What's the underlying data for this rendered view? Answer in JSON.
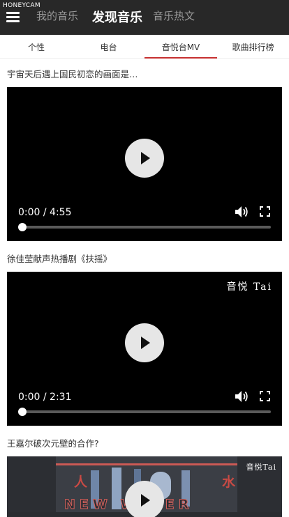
{
  "watermark": "HONEYCAM",
  "header": {
    "tabs": [
      {
        "label": "我的音乐"
      },
      {
        "label": "发现音乐"
      },
      {
        "label": "音乐热文"
      }
    ]
  },
  "subtabs": [
    {
      "label": "个性"
    },
    {
      "label": "电台"
    },
    {
      "label": "音悦台MV"
    },
    {
      "label": "歌曲排行榜"
    }
  ],
  "videos": [
    {
      "title": "宇宙天后遇上国民初恋的画面是…",
      "time": "0:00 / 4:55",
      "progress": 0
    },
    {
      "title": "徐佳莹献声热播剧《扶摇》",
      "time": "0:00 / 2:31",
      "progress": 0,
      "logo": "音悦 Tai"
    },
    {
      "title": "王嘉尔破次元壁的合作?",
      "logo": "音悦Tai",
      "scene_text": "NEW WATER",
      "scene_chars": [
        "人",
        "水"
      ]
    }
  ],
  "colors": {
    "topbar": "#282828",
    "accent": "#c62f2f"
  }
}
